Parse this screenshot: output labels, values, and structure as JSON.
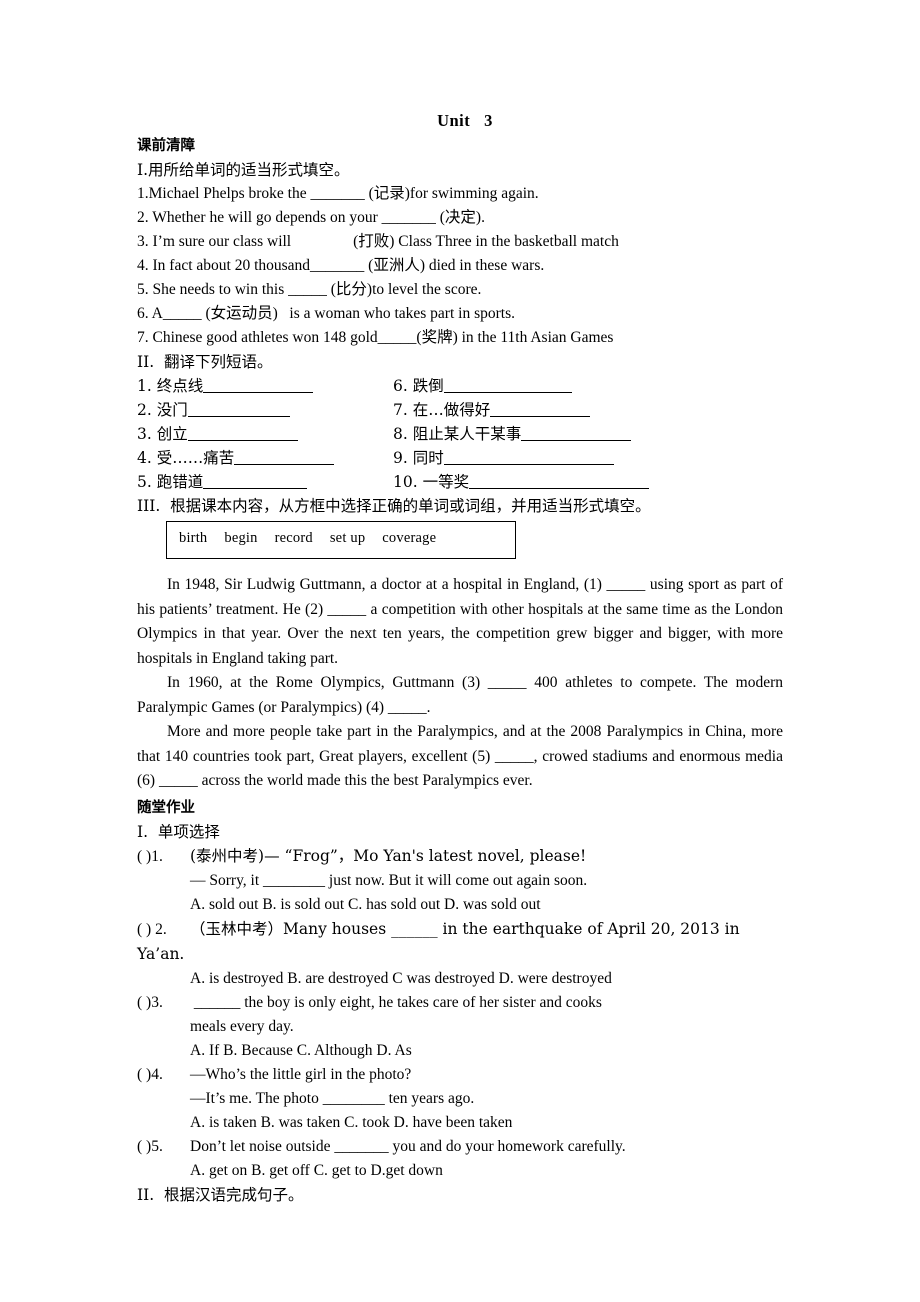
{
  "document": {
    "unit_title": "Unit   3",
    "section_pre": {
      "heading": "课前清障",
      "part1": {
        "label": "I.用所给单词的适当形式填空。",
        "items": [
          "1.Michael Phelps broke the _______ (记录)for swimming again.",
          "2. Whether he will go depends on your _______ (决定).",
          "3. I’m sure our class will                (打败) Class Three in the basketball match",
          "4. In fact about 20 thousand_______ (亚洲人) died in these wars.",
          "5. She needs to win this _____ (比分)to level the score.",
          "6. A_____ (女运动员)   is a woman who takes part in sports.",
          "7. Chinese good athletes won 148 gold_____(奖牌) in the 11th Asian Games"
        ]
      },
      "part2": {
        "label": "II.  翻译下列短语。",
        "pairs": [
          {
            "left_num": "1.",
            "left_text": "终点线",
            "left_rule": 110,
            "right_num": "6.",
            "right_text": "跌倒",
            "right_rule": 128
          },
          {
            "left_num": "2.",
            "left_text": "没门",
            "left_rule": 102,
            "right_num": "7.",
            "right_text": "在…做得好",
            "right_rule": 100
          },
          {
            "left_num": "3.",
            "left_text": "创立",
            "left_rule": 110,
            "right_num": "8.",
            "right_text": "阻止某人干某事",
            "right_rule": 110
          },
          {
            "left_num": "4.",
            "left_text": "受……痛苦",
            "left_rule": 100,
            "right_num": "9.",
            "right_text": "同时",
            "right_rule": 170
          },
          {
            "left_num": "5.",
            "left_text": "跑错道",
            "left_rule": 104,
            "right_num": "10.",
            "right_text": "一等奖",
            "right_rule": 180
          }
        ]
      },
      "part3": {
        "label": "III.  根据课本内容，从方框中选择正确的单词或词组，并用适当形式填空。",
        "word_bank": [
          "birth",
          "begin",
          "record",
          "set up",
          "coverage"
        ],
        "passage": [
          "In 1948, Sir Ludwig Guttmann, a doctor at a hospital in England, (1) _____ using sport as part of his patients’ treatment. He (2) _____ a competition with other hospitals at the same time as the London Olympics in that year. Over the next ten years, the competition grew bigger and bigger, with more hospitals in England taking part.",
          "In 1960, at the Rome Olympics, Guttmann (3) _____ 400 athletes to compete. The modern Paralympic Games (or Paralympics) (4) _____.",
          "More and more people take part in the Paralympics, and at the 2008 Paralympics in China, more that 140 countries took part, Great players, excellent (5) _____, crowed stadiums and enormous media (6) _____ across the world made this the best Paralympics ever."
        ]
      }
    },
    "section_class": {
      "heading": "随堂作业",
      "part1_label": "I.  单项选择",
      "questions": [
        {
          "lead": "(          )1.",
          "stem": "(泰州中考)— “Frog”，Mo Yan's latest novel, please!",
          "cont": "— Sorry, it ________ just now. But it will come out again soon.",
          "options": "A. sold out          B. is sold out         C. has sold out     D. was sold out"
        },
        {
          "lead": "(          ) 2.",
          "stem": "（玉林中考）Many houses ______ in the earthquake of April 20, 2013 in Ya’an.",
          "cont": "",
          "options": "A. is destroyed   B. are destroyed   C was destroyed  D. were destroyed"
        },
        {
          "lead": "(          )3.",
          "stem": "  ______ the boy is only eight, he takes care of her sister and cooks",
          "cont": "meals every day.",
          "options": " A. If          B. Because           C. Although           D. As"
        },
        {
          "lead": "(          )4.",
          "stem": "—Who’s the little girl in the photo?",
          "cont": "—It’s me. The photo ________ ten years ago.",
          "options": " A. is taken          B. was taken         C. took          D. have been taken"
        },
        {
          "lead": "(          )5.",
          "stem": "Don’t let noise outside _______ you and do your homework carefully.",
          "cont": "",
          "options": " A. get on    B. get off     C. get to        D.get down"
        }
      ],
      "part2_label": "II.  根据汉语完成句子。"
    }
  }
}
